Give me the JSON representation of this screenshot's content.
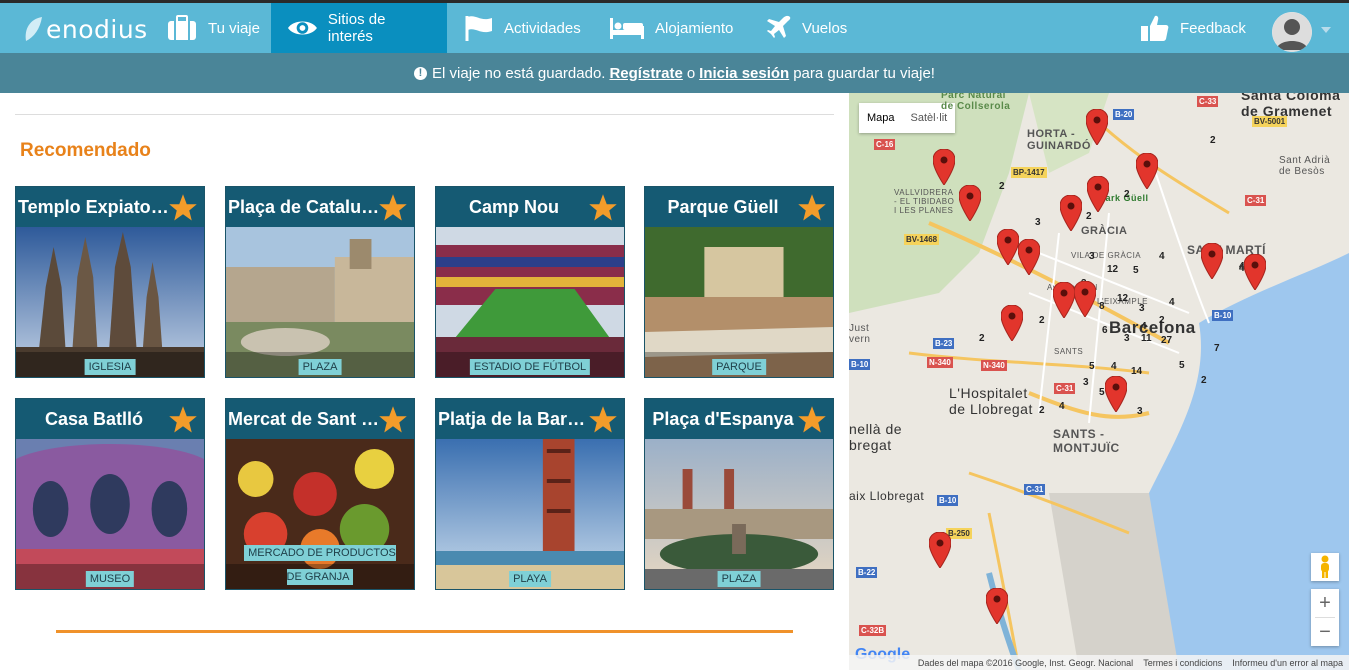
{
  "header": {
    "logo": "enodius",
    "nav": [
      {
        "label": "Tu viaje",
        "icon": "suitcase-icon"
      },
      {
        "label": "Sitios de interés",
        "icon": "eye-icon"
      },
      {
        "label": "Actividades",
        "icon": "flag-icon"
      },
      {
        "label": "Alojamiento",
        "icon": "bed-icon"
      },
      {
        "label": "Vuelos",
        "icon": "plane-icon"
      }
    ],
    "feedback": "Feedback",
    "active_tab": "Sitios de interés"
  },
  "notice": {
    "pre": "El viaje no está guardado.",
    "register": "Regístrate",
    "or": "o",
    "login": "Inicia sesión",
    "post": "para guardar tu viaje!"
  },
  "section": {
    "title": "Recomendado"
  },
  "cards": [
    {
      "title": "Templo Expiatori...",
      "tag": "IGLESIA"
    },
    {
      "title": "Plaça de Catalun...",
      "tag": "PLAZA"
    },
    {
      "title": "Camp Nou",
      "tag": "ESTADIO DE FÚTBOL"
    },
    {
      "title": "Parque Güell",
      "tag": "PARQUE"
    },
    {
      "title": "Casa Batlló",
      "tag": "MUSEO"
    },
    {
      "title": "Mercat de Sant J...",
      "tag": "MERCADO DE PRODUCTOS DE GRANJA"
    },
    {
      "title": "Platja de la Barce...",
      "tag": "PLAYA"
    },
    {
      "title": "Plaça d'Espanya",
      "tag": "PLAZA"
    }
  ],
  "map": {
    "type_map": "Mapa",
    "type_sat": "Satèl·lit",
    "zoom_in": "+",
    "zoom_out": "−",
    "attribution": "Dades del mapa ©2016 Google, Inst. Geogr. Nacional",
    "terms": "Termes i condicions",
    "report": "Informeu d'un error al mapa",
    "google": "Google",
    "places": {
      "barcelona": "Barcelona",
      "hospitalet1": "L'Hospitalet",
      "hospitalet2": "de Llobregat",
      "horta1": "HORTA -",
      "horta2": "GUINARDÓ",
      "gracia": "GRÀCIA",
      "sants": "SANTS -",
      "montjuic": "MONTJUÏC",
      "santmarti": "SANT MARTÍ",
      "santacoloma1": "Santa Coloma",
      "santacoloma2": "de Gramenet",
      "santadria1": "Sant Adrià",
      "santadria2": "de Besòs",
      "vallvidrera1": "VALLVIDRERA",
      "vallvidrera2": "- EL TIBIDABO",
      "vallvidrera3": "I LES PLANES",
      "parcnatural1": "Parc Natural",
      "parcnatural2": "de Collserola",
      "cornella1": "nellà de",
      "cornella2": "bregat",
      "justdesvern1": "Just",
      "justdesvern2": "vern",
      "prat": "aix Llobregat",
      "parkguell": "Park Güell",
      "vila": "VILA DE GRÀCIA",
      "eixample": "L'EIXAMPLE",
      "sants2": "SANTS",
      "av": "Av. Diagonal"
    },
    "roads": [
      "C-33",
      "B-20",
      "BV-5001",
      "C-16",
      "BP-1417",
      "C-31",
      "BV-1468",
      "B-10",
      "B-23",
      "N-340",
      "N-340",
      "C-31",
      "B-10",
      "B-10",
      "B-250",
      "C-31",
      "B-22",
      "C-32B"
    ],
    "clusters": [
      "2",
      "2",
      "3",
      "2",
      "2",
      "3",
      "4",
      "12",
      "5",
      "4",
      "3",
      "8",
      "12",
      "3",
      "4",
      "2",
      "4",
      "2",
      "6",
      "3",
      "11",
      "27",
      "7",
      "5",
      "4",
      "14",
      "2",
      "5",
      "3",
      "2",
      "2",
      "4",
      "3",
      "5",
      "4"
    ]
  }
}
